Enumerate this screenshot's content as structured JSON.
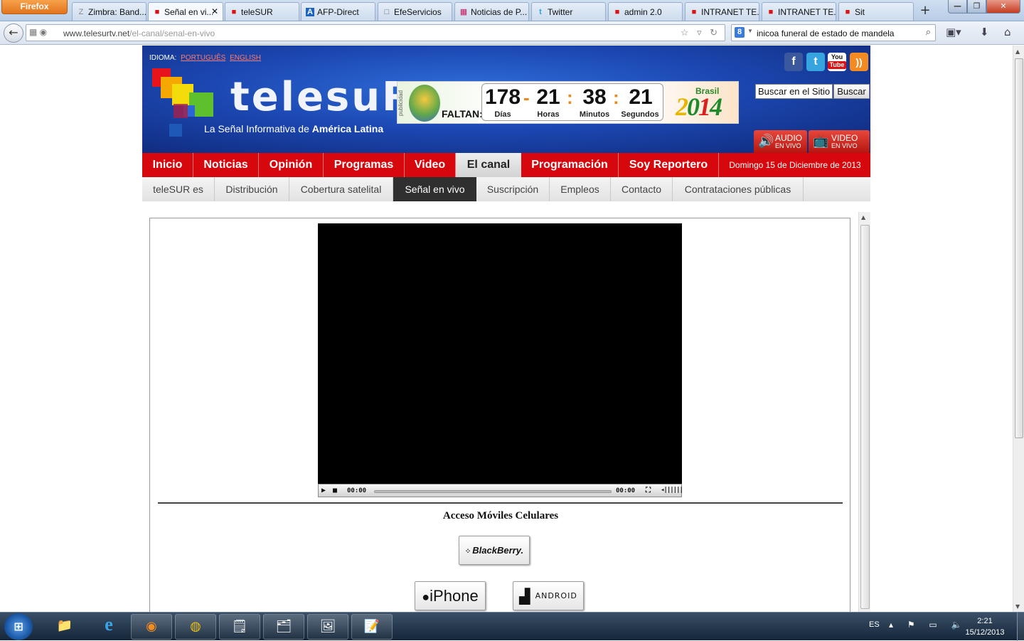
{
  "browser": {
    "menu_button": "Firefox",
    "tabs": [
      {
        "label": "Zimbra: Band...",
        "icon": "zimbra-icon",
        "glyph": "Z"
      },
      {
        "label": "Señal en vi...",
        "icon": "telesur-icon",
        "glyph": "■",
        "active": true
      },
      {
        "label": "teleSUR",
        "icon": "telesur-icon",
        "glyph": "■"
      },
      {
        "label": "AFP-Direct",
        "icon": "afp-icon",
        "glyph": "A"
      },
      {
        "label": "EfeServicios",
        "icon": "page-icon",
        "glyph": "□"
      },
      {
        "label": "Noticias de P...",
        "icon": "news-icon",
        "glyph": "▦"
      },
      {
        "label": "Twitter",
        "icon": "twitter-icon",
        "glyph": "t"
      },
      {
        "label": "admin 2.0",
        "icon": "telesur-icon",
        "glyph": "■"
      },
      {
        "label": "INTRANET TE...",
        "icon": "telesur-icon",
        "glyph": "■"
      },
      {
        "label": "INTRANET TE...",
        "icon": "telesur-icon",
        "glyph": "■"
      },
      {
        "label": "Sit",
        "icon": "telesur-icon",
        "glyph": "■"
      }
    ],
    "url_host": "www.telesurtv.net",
    "url_path": "/el-canal/senal-en-vivo",
    "search_value": "inicoa funeral de estado de mandela",
    "search_engine": "8"
  },
  "site": {
    "language_label": "IDIOMA:",
    "lang_pt": "PORTUGUÊS",
    "lang_en": "ENGLISH",
    "logo_text": "telesuR",
    "tagline_prefix": "La Señal Informativa de ",
    "tagline_bold": "América Latina",
    "search_placeholder": "Buscar en el Sitio",
    "search_button": "Buscar",
    "social": {
      "facebook": "f",
      "twitter": "t",
      "youtube_line1": "You",
      "youtube_line2": "Tube",
      "rss": "))"
    },
    "audio_live_1": "AUDIO",
    "audio_live_2": "EN VIVO",
    "video_live_1": "VIDEO",
    "video_live_2": "EN VIVO",
    "countdown": {
      "pub_label": "publicidad",
      "faltan": "FALTAN:",
      "days": "178",
      "hours": "21",
      "minutes": "38",
      "seconds": "21",
      "days_label": "Días",
      "hours_label": "Horas",
      "minutes_label": "Minutos",
      "seconds_label": "Segundos",
      "brand_word": "Brasil",
      "year_a": "2",
      "year_b": "0",
      "year_c": "1",
      "year_d": "4"
    },
    "main_nav": [
      "Inicio",
      "Noticias",
      "Opinión",
      "Programas",
      "Video",
      "El canal",
      "Programación",
      "Soy Reportero"
    ],
    "nav_date": "Domingo 15 de Diciembre de 2013",
    "sub_nav": [
      "teleSUR es",
      "Distribución",
      "Cobertura satelital",
      "Señal en vivo",
      "Suscripción",
      "Empleos",
      "Contacto",
      "Contrataciones públicas"
    ]
  },
  "player": {
    "time_current": "00:00",
    "time_total": "00:00"
  },
  "mobile": {
    "title": "Acceso Móviles Celulares",
    "blackberry": "BlackBerry.",
    "iphone": "iPhone",
    "android": "ANDROID"
  },
  "taskbar": {
    "lang": "ES",
    "time": "2:21",
    "date": "15/12/2013"
  }
}
